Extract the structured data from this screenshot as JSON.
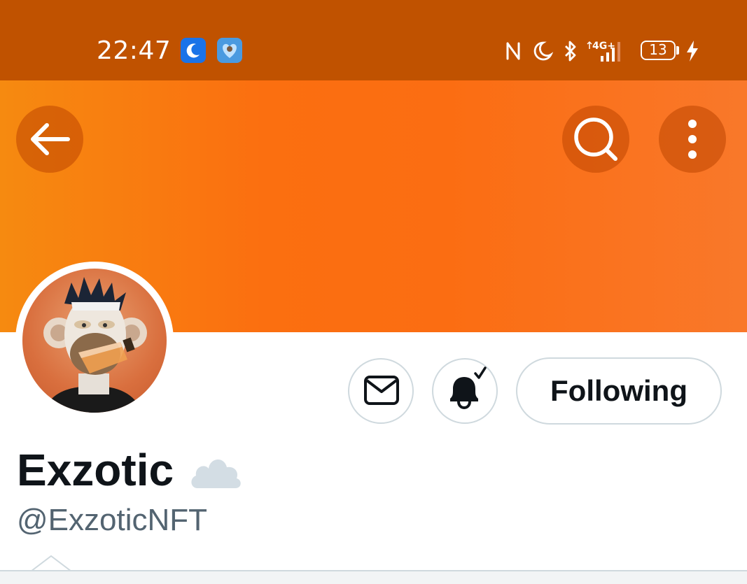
{
  "status_bar": {
    "time": "22:47",
    "battery_level": "13",
    "icons": [
      "moon-app-icon",
      "heart-app-icon",
      "nfc-icon",
      "do-not-disturb-icon",
      "bluetooth-icon",
      "signal-4g-icon",
      "battery-icon",
      "charging-icon"
    ]
  },
  "header": {
    "back_icon": "arrow-left-icon",
    "search_icon": "search-icon",
    "more_icon": "more-vertical-icon"
  },
  "profile": {
    "display_name": "Exzotic",
    "handle": "@ExzoticNFT",
    "name_emoji": "cloud-icon"
  },
  "actions": {
    "message_icon": "mail-icon",
    "notify_icon": "bell-check-icon",
    "follow_label": "Following"
  },
  "colors": {
    "status_bar": "#c05200",
    "banner": "#fb6f10",
    "text_primary": "#0f1419",
    "text_secondary": "#536471",
    "border": "#cfd9de"
  }
}
